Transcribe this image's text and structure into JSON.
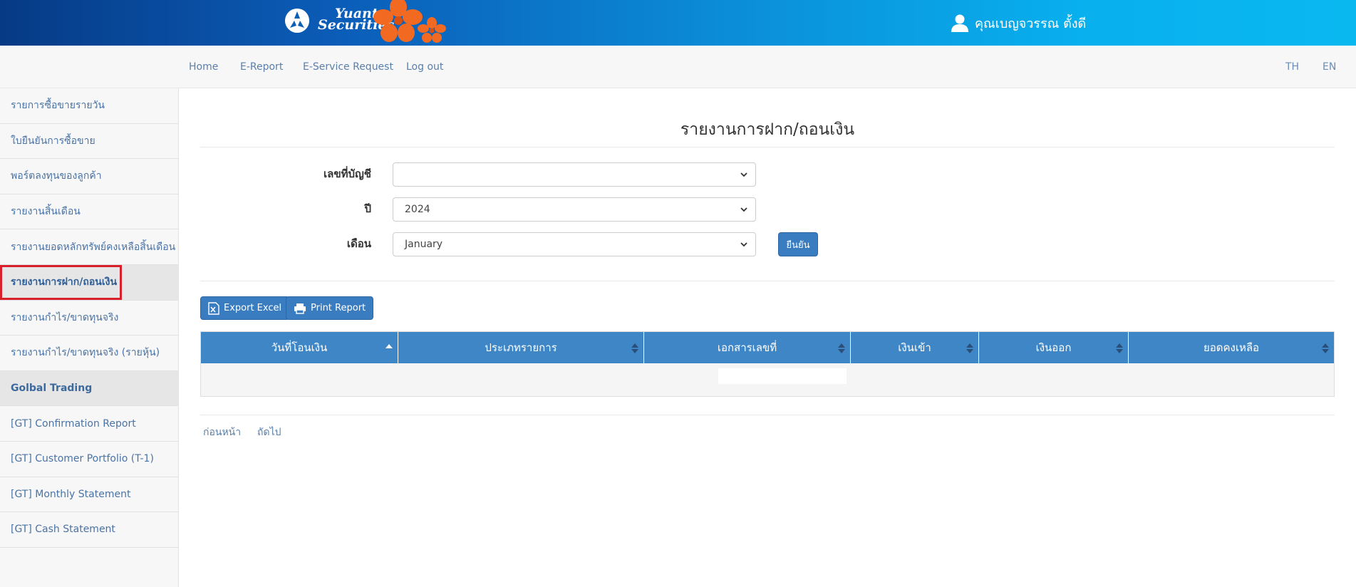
{
  "header": {
    "brand_line1": "Yuanta",
    "brand_line2": "Securities",
    "user_name": "คุณเบญจวรรณ ตั้งดี"
  },
  "topnav": {
    "items": [
      "Home",
      "E-Report",
      "E-Service Request",
      "Log out"
    ],
    "lang_th": "TH",
    "lang_en": "EN"
  },
  "sidebar": {
    "items": [
      "รายการซื้อขายรายวัน",
      "ใบยืนยันการซื้อขาย",
      "พอร์ตลงทุนของลูกค้า",
      "รายงานสิ้นเดือน",
      "รายงานยอดหลักทรัพย์คงเหลือสิ้นเดือน",
      "รายงานการฝาก/ถอนเงิน",
      "รายงานกำไร/ขาดทุนจริง",
      "รายงานกำไร/ขาดทุนจริง (รายหุ้น)",
      "Golbal Trading",
      "[GT] Confirmation Report",
      "[GT] Customer Portfolio (T-1)",
      "[GT] Monthly Statement",
      "[GT] Cash Statement"
    ]
  },
  "main": {
    "title": "รายงานการฝาก/ถอนเงิน",
    "form": {
      "account_label": "เลขที่บัญชี",
      "account_value": "",
      "year_label": "ปี",
      "year_value": "2024",
      "month_label": "เดือน",
      "month_value": "January",
      "confirm_label": "ยืนยัน"
    },
    "export_excel_label": "Export Excel",
    "print_report_label": "Print Report",
    "table": {
      "columns": [
        "วันที่โอนเงิน",
        "ประเภทรายการ",
        "เอกสารเลขที่",
        "เงินเข้า",
        "เงินออก",
        "ยอดคงเหลือ"
      ]
    },
    "pager": {
      "prev": "ก่อนหน้า",
      "next": "ถัดไป"
    }
  },
  "colors": {
    "header_start": "#063a85",
    "header_end": "#0ab8f0",
    "accent_blue": "#3a7cc0",
    "table_header": "#3f86c7",
    "active_highlight": "#d9202a",
    "flower_orange": "#f26a21"
  }
}
